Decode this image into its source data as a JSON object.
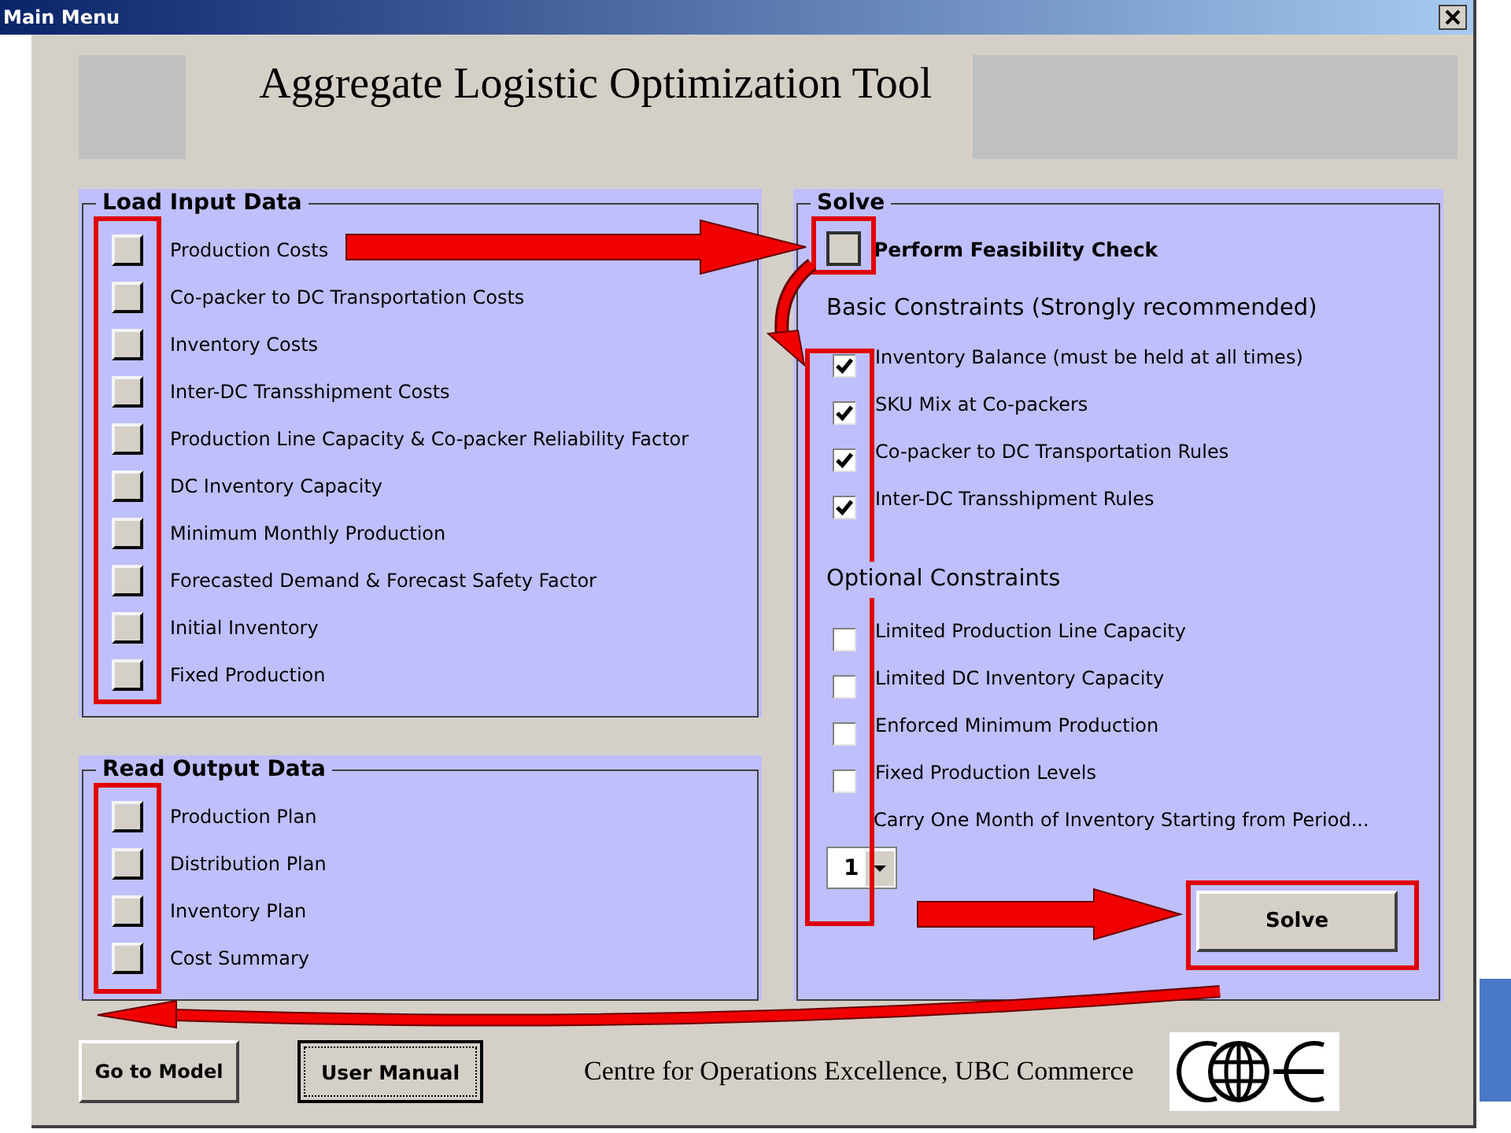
{
  "window": {
    "title": "Main Menu"
  },
  "header": {
    "title": "Aggregate Logistic Optimization Tool"
  },
  "load_input": {
    "label": "Load Input Data",
    "items": [
      {
        "label": "Production Costs"
      },
      {
        "label": "Co-packer to DC Transportation Costs"
      },
      {
        "label": "Inventory Costs"
      },
      {
        "label": "Inter-DC Transshipment Costs"
      },
      {
        "label": "Production Line Capacity & Co-packer Reliability Factor"
      },
      {
        "label": "DC Inventory Capacity"
      },
      {
        "label": "Minimum Monthly Production"
      },
      {
        "label": "Forecasted Demand & Forecast Safety Factor"
      },
      {
        "label": "Initial Inventory"
      },
      {
        "label": "Fixed Production"
      }
    ]
  },
  "read_output": {
    "label": "Read Output Data",
    "items": [
      {
        "label": "Production Plan"
      },
      {
        "label": "Distribution Plan"
      },
      {
        "label": "Inventory Plan"
      },
      {
        "label": "Cost Summary"
      }
    ]
  },
  "solve": {
    "label": "Solve",
    "feasibility": {
      "label": "Perform Feasibility Check",
      "checked": false
    },
    "basic_heading": "Basic Constraints (Strongly recommended)",
    "basic": [
      {
        "label": "Inventory Balance (must be held at all times)",
        "checked": true
      },
      {
        "label": "SKU Mix at Co-packers",
        "checked": true
      },
      {
        "label": "Co-packer to DC Transportation Rules",
        "checked": true
      },
      {
        "label": "Inter-DC Transshipment Rules",
        "checked": true
      }
    ],
    "optional_heading": "Optional Constraints",
    "optional": [
      {
        "label": "Limited Production Line Capacity",
        "checked": false
      },
      {
        "label": "Limited DC Inventory Capacity",
        "checked": false
      },
      {
        "label": "Enforced Minimum Production",
        "checked": false
      },
      {
        "label": "Fixed Production Levels",
        "checked": false
      }
    ],
    "carry_label": "Carry One Month of Inventory Starting from Period...",
    "period": "1",
    "solve_button": "Solve"
  },
  "footer": {
    "buttons": [
      {
        "label": "Go to Model",
        "focused": false
      },
      {
        "label": "User Manual",
        "focused": true
      }
    ],
    "credit": "Centre for Operations Excellence, UBC Commerce"
  }
}
